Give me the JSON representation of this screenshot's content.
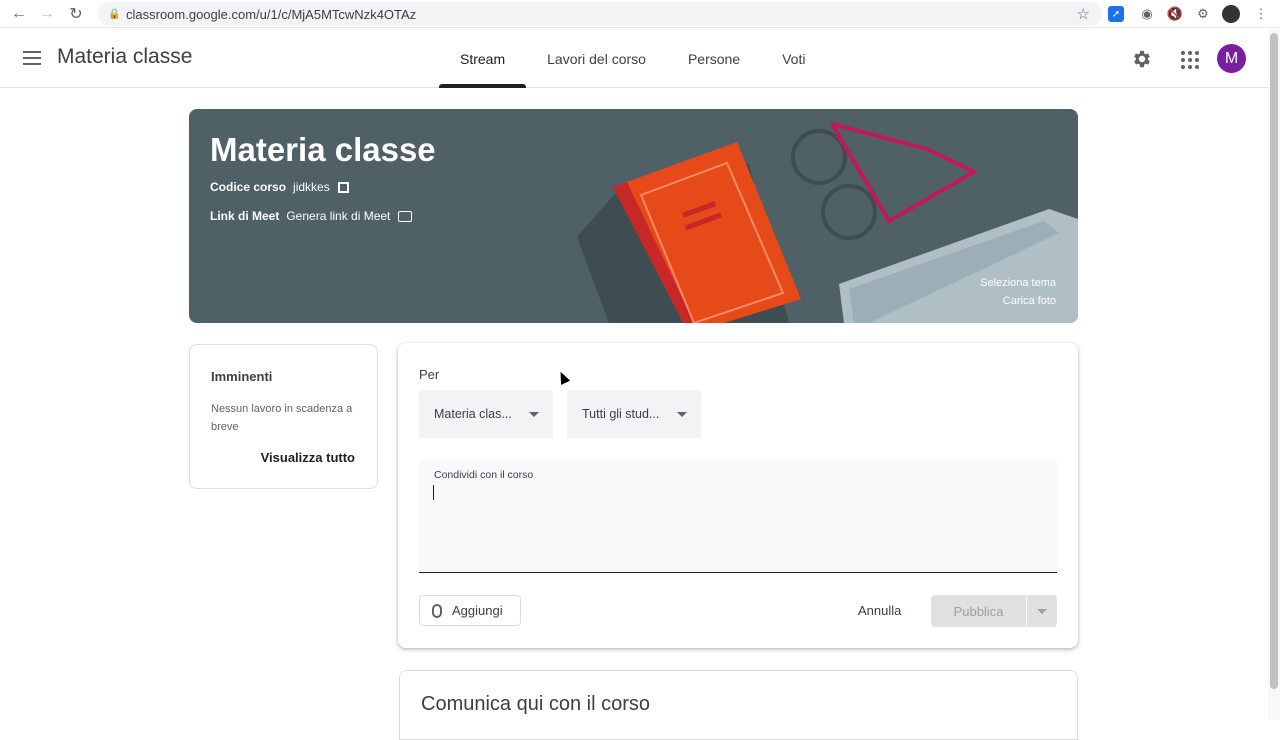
{
  "browser": {
    "url": "classroom.google.com/u/1/c/MjA5MTcwNzk4OTAz"
  },
  "header": {
    "title": "Materia classe",
    "tabs": [
      {
        "label": "Stream",
        "active": true
      },
      {
        "label": "Lavori del corso",
        "active": false
      },
      {
        "label": "Persone",
        "active": false
      },
      {
        "label": "Voti",
        "active": false
      }
    ],
    "avatar_letter": "M",
    "avatar_color": "#7b1fa2"
  },
  "banner": {
    "title": "Materia classe",
    "code_label": "Codice corso",
    "code_value": "jidkkes",
    "meet_label": "Link di Meet",
    "meet_value": "Genera link di Meet",
    "select_theme": "Seleziona tema",
    "upload_photo": "Carica foto",
    "background_color": "#4f6066"
  },
  "upcoming": {
    "title": "Imminenti",
    "message": "Nessun lavoro in scadenza a breve",
    "view_all": "Visualizza tutto"
  },
  "composer": {
    "for_label": "Per",
    "class_select": "Materia clas...",
    "students_select": "Tutti gli stud...",
    "placeholder": "Condividi con il corso",
    "add_button": "Aggiungi",
    "cancel_button": "Annulla",
    "publish_button": "Pubblica"
  },
  "announce": {
    "title": "Comunica qui con il corso"
  }
}
